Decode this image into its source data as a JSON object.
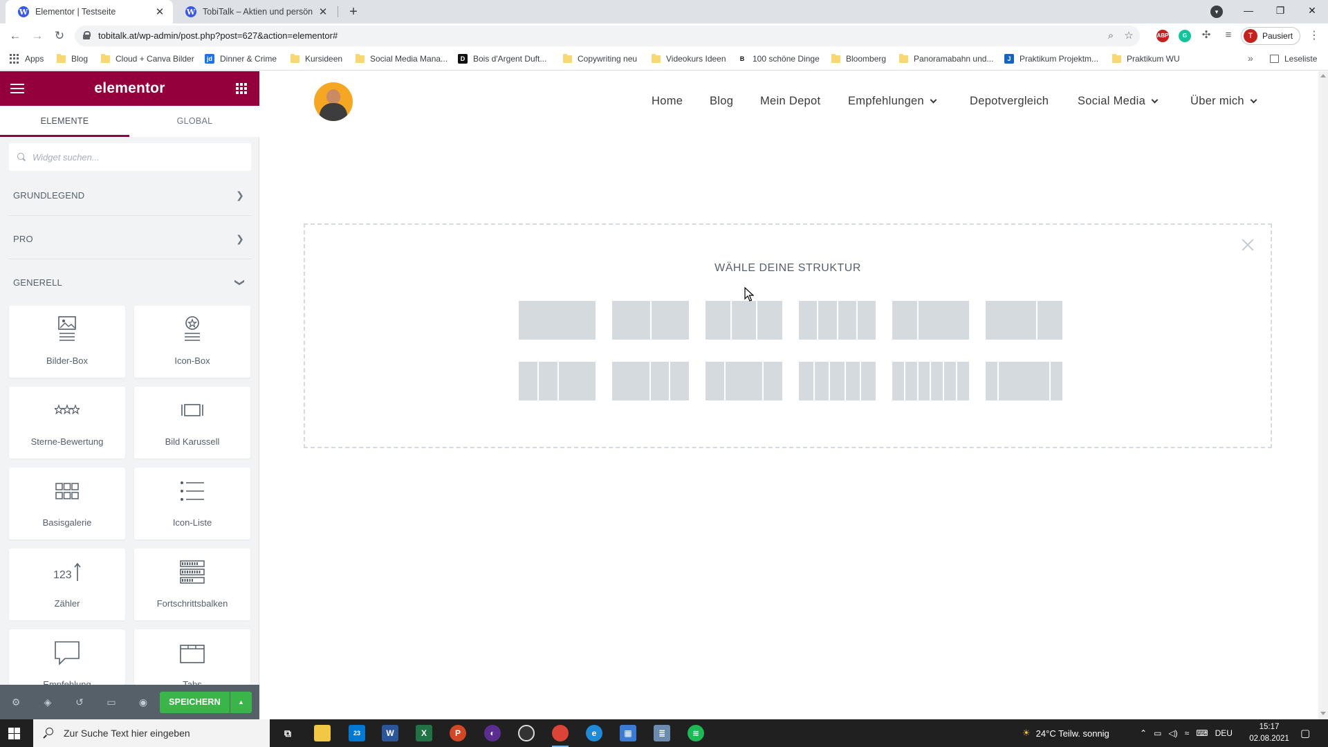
{
  "browser": {
    "tabs": [
      {
        "title": "Elementor | Testseite",
        "active": true,
        "favicon": "wordpress-icon"
      },
      {
        "title": "TobiTalk – Aktien und persönliche",
        "active": false,
        "favicon": "wordpress-icon"
      }
    ],
    "new_tab_symbol": "+",
    "url": "tobitalk.at/wp-admin/post.php?post=627&action=elementor#",
    "profile_initial": "T",
    "profile_status": "Pausiert",
    "extensions": [
      {
        "name": "abp-icon",
        "label": "ABP",
        "color": "#c5221f"
      },
      {
        "name": "grammarly-icon",
        "label": "G",
        "color": "#15c39a"
      }
    ],
    "bookmarks": [
      {
        "label": "Apps",
        "icon": "apps-grid-icon"
      },
      {
        "label": "Blog",
        "icon": "folder-icon"
      },
      {
        "label": "Cloud + Canva Bilder",
        "icon": "folder-icon"
      },
      {
        "label": "Dinner & Crime",
        "icon": "jd-icon"
      },
      {
        "label": "Kursideen",
        "icon": "folder-icon"
      },
      {
        "label": "Social Media Mana...",
        "icon": "folder-icon"
      },
      {
        "label": "Bois d'Argent Duft...",
        "icon": "dior-icon"
      },
      {
        "label": "Copywriting neu",
        "icon": "folder-icon"
      },
      {
        "label": "Videokurs Ideen",
        "icon": "folder-icon"
      },
      {
        "label": "100 schöne Dinge",
        "icon": "b-icon"
      },
      {
        "label": "Bloomberg",
        "icon": "folder-icon"
      },
      {
        "label": "Panoramabahn und...",
        "icon": "folder-icon"
      },
      {
        "label": "Praktikum Projektm...",
        "icon": "j-icon"
      },
      {
        "label": "Praktikum WU",
        "icon": "folder-icon"
      }
    ],
    "more_bookmarks": "»",
    "reading_list": "Leseliste"
  },
  "elementor": {
    "brand": "elementor",
    "tabs": [
      {
        "label": "ELEMENTE",
        "active": true
      },
      {
        "label": "GLOBAL",
        "active": false
      }
    ],
    "search_placeholder": "Widget suchen...",
    "categories": [
      {
        "label": "GRUNDLEGEND",
        "state": "collapsed"
      },
      {
        "label": "PRO",
        "state": "collapsed"
      },
      {
        "label": "GENERELL",
        "state": "expanded"
      }
    ],
    "widgets": [
      {
        "label": "Bilder-Box",
        "icon": "image-box-icon"
      },
      {
        "label": "Icon-Box",
        "icon": "icon-box-icon"
      },
      {
        "label": "Sterne-Bewertung",
        "icon": "star-rating-icon"
      },
      {
        "label": "Bild Karussell",
        "icon": "image-carousel-icon"
      },
      {
        "label": "Basisgalerie",
        "icon": "gallery-icon"
      },
      {
        "label": "Icon-Liste",
        "icon": "icon-list-icon"
      },
      {
        "label": "Zähler",
        "icon": "counter-icon"
      },
      {
        "label": "Fortschrittsbalken",
        "icon": "progress-bar-icon"
      },
      {
        "label": "Empfehlung",
        "icon": "testimonial-icon"
      },
      {
        "label": "Tabs",
        "icon": "tabs-icon"
      }
    ],
    "save_label": "SPEICHERN",
    "accent_color": "#93003c",
    "save_color": "#39b54a"
  },
  "site": {
    "nav": [
      {
        "label": "Home",
        "dropdown": false
      },
      {
        "label": "Blog",
        "dropdown": false
      },
      {
        "label": "Mein Depot",
        "dropdown": false
      },
      {
        "label": "Empfehlungen",
        "dropdown": true
      },
      {
        "label": "Depotvergleich",
        "dropdown": false
      },
      {
        "label": "Social Media",
        "dropdown": true
      },
      {
        "label": "Über mich",
        "dropdown": true
      }
    ],
    "structure_title": "WÄHLE DEINE STRUKTUR",
    "structure_presets": [
      [
        100
      ],
      [
        50,
        50
      ],
      [
        33,
        33,
        33
      ],
      [
        25,
        25,
        25,
        25
      ],
      [
        33,
        66
      ],
      [
        66,
        33
      ],
      [
        25,
        25,
        50
      ],
      [
        50,
        25,
        25
      ],
      [
        25,
        50,
        25
      ],
      [
        20,
        20,
        20,
        20,
        20
      ],
      [
        16,
        16,
        16,
        16,
        16,
        16
      ],
      [
        16,
        66,
        16
      ]
    ]
  },
  "taskbar": {
    "search_placeholder": "Zur Suche Text hier eingeben",
    "mail_badge": "23",
    "weather": "24°C  Teilw. sonnig",
    "language": "DEU",
    "time": "15:17",
    "date": "02.08.2021"
  }
}
